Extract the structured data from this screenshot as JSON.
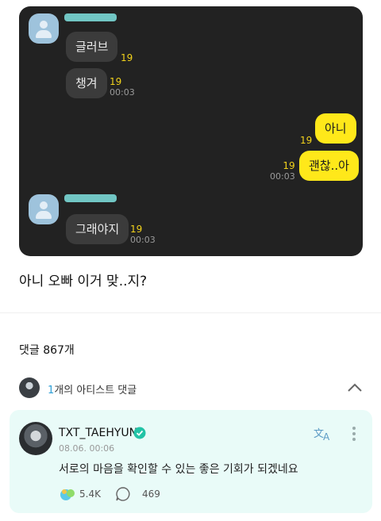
{
  "chat": {
    "messages": [
      {
        "text": "글러브",
        "count": "19",
        "time": ""
      },
      {
        "text": "챙겨",
        "count": "19",
        "time": "00:03"
      },
      {
        "text": "아니",
        "count": "19",
        "time": ""
      },
      {
        "text": "괜찮..아",
        "count": "19",
        "time": "00:03"
      },
      {
        "text": "그래야지",
        "count": "19",
        "time": "00:03"
      }
    ]
  },
  "post": {
    "caption": "아니 오빠 이거 맞..지?"
  },
  "comments": {
    "count_label": "댓글 867개",
    "artist_count": "1",
    "artist_label": "개의 아티스트 댓글",
    "item": {
      "author": "TXT_TAEHYUN",
      "date": "08.06. 00:06",
      "text": "서로의 마음을 확인할 수 있는 좋은 기회가 되겠네요",
      "likes": "5.4K",
      "replies": "469"
    }
  },
  "colors": {
    "accent": "#2f9fd6",
    "chat_bg": "#222222",
    "out_bubble": "#ffe81a",
    "comment_bg": "#e9fbf8"
  },
  "icons": [
    "person-avatar-icon",
    "chevron-up-icon",
    "verified-icon",
    "translate-icon",
    "more-icon",
    "reaction-icon",
    "reply-icon"
  ]
}
